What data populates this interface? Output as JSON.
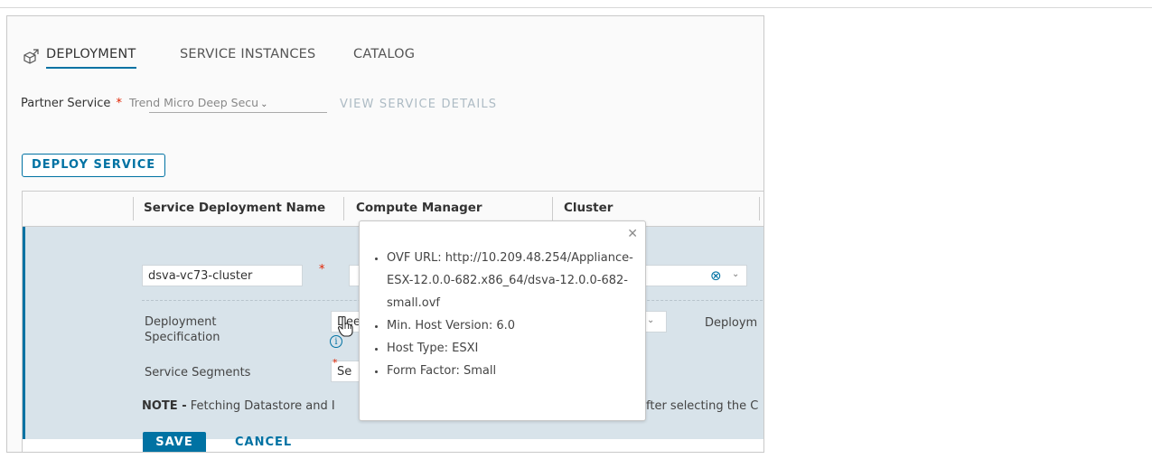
{
  "tabs": [
    {
      "label": "DEPLOYMENT",
      "active": true
    },
    {
      "label": "SERVICE INSTANCES",
      "active": false
    },
    {
      "label": "CATALOG",
      "active": false
    }
  ],
  "partner_service": {
    "label": "Partner Service",
    "required_mark": "*",
    "value": "Trend Micro Deep Secu",
    "view_details_link": "VIEW SERVICE DETAILS"
  },
  "deploy_button": "DEPLOY SERVICE",
  "grid": {
    "columns": [
      "Service Deployment Name",
      "Compute Manager",
      "Cluster"
    ],
    "row": {
      "name_value": "dsva-vc73-cluster",
      "required_mark": "*",
      "deployment_spec_label": "Deployment Specification",
      "deployment_spec_value": "Dee",
      "deployment_tail": "Deploym",
      "service_segments_label": "Service Segments",
      "service_segments_value": "Se",
      "note_prefix": "NOTE -",
      "note_text": " Fetching Datastore and I",
      "note_tail": "fter selecting the C",
      "save": "SAVE",
      "cancel": "CANCEL"
    }
  },
  "popover": {
    "items": [
      "OVF URL: http://10.209.48.254/Appliance-ESX-12.0.0-682.x86_64/dsva-12.0.0-682-small.ovf",
      "Min. Host Version: 6.0",
      "Host Type: ESXI",
      "Form Factor: Small"
    ]
  },
  "colors": {
    "accent": "#0072a3",
    "row_bg": "#d8e3ea",
    "required": "#e12200"
  },
  "icons": {
    "tab_icon": "services-cube-icon",
    "clear": "clear-circle-icon",
    "info": "info-circle-icon",
    "close": "close-icon"
  }
}
